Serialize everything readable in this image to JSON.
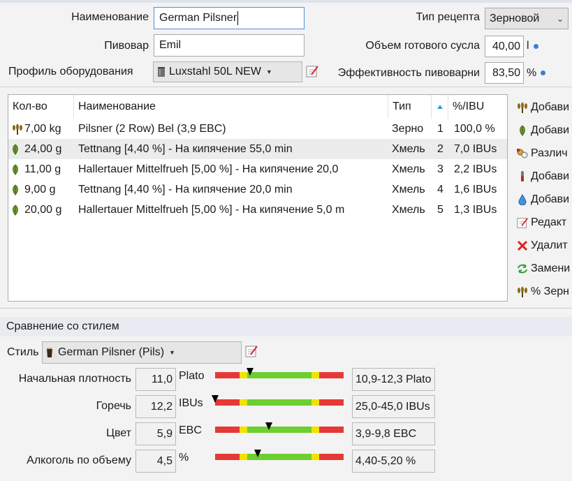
{
  "header": {
    "name_label": "Наименование",
    "name_value": "German Pilsner",
    "brewer_label": "Пивовар",
    "brewer_value": "Emil",
    "equipment_label": "Профиль оборудования",
    "equipment_value": "Luxstahl 50L NEW",
    "recipe_type_label": "Тип рецепта",
    "recipe_type_value": "Зерновой",
    "batch_volume_label": "Объем готового сусла",
    "batch_volume_value": "40,00",
    "batch_volume_unit": "l",
    "efficiency_label": "Эффективность пивоварни",
    "efficiency_value": "83,50",
    "efficiency_unit": "%"
  },
  "ingredients": {
    "columns": {
      "qty": "Кол-во",
      "name": "Наименование",
      "type": "Тип",
      "order_icon": "hop-order-icon",
      "pct": "%/IBU"
    },
    "rows": [
      {
        "icon": "grain-icon",
        "qty": "7,00 kg",
        "name": "Pilsner (2 Row) Bel (3,9 EBC)",
        "type": "Зерно",
        "order": "1",
        "pct": "100,0 %"
      },
      {
        "icon": "hop-icon",
        "qty": "24,00 g",
        "name": "Tettnang [4,40 %] - На кипячение 55,0 min",
        "type": "Хмель",
        "order": "2",
        "pct": "7,0 IBUs"
      },
      {
        "icon": "hop-icon",
        "qty": "11,00 g",
        "name": "Hallertauer Mittelfrueh [5,00 %] - На кипячение 20,0",
        "type": "Хмель",
        "order": "3",
        "pct": "2,2 IBUs"
      },
      {
        "icon": "hop-icon",
        "qty": "9,00 g",
        "name": "Tettnang [4,40 %] - На кипячение 20,0 min",
        "type": "Хмель",
        "order": "4",
        "pct": "1,6 IBUs"
      },
      {
        "icon": "hop-icon",
        "qty": "20,00 g",
        "name": "Hallertauer Mittelfrueh [5,00 %] - На кипячение 5,0 m",
        "type": "Хмель",
        "order": "5",
        "pct": "1,3 IBUs"
      }
    ]
  },
  "actions": [
    {
      "icon": "grain-icon",
      "label": "Добави"
    },
    {
      "icon": "hop-icon",
      "label": "Добави"
    },
    {
      "icon": "misc-icon",
      "label": "Различ"
    },
    {
      "icon": "yeast-icon",
      "label": "Добави"
    },
    {
      "icon": "water-icon",
      "label": "Добави"
    },
    {
      "icon": "edit-icon",
      "label": "Редакт"
    },
    {
      "icon": "delete-icon",
      "label": "Удалит"
    },
    {
      "icon": "replace-icon",
      "label": "Замени"
    },
    {
      "icon": "grain-icon",
      "label": "% Зерн"
    }
  ],
  "style": {
    "section_title": "Сравнение со стилем",
    "style_label": "Стиль",
    "style_value": "German Pilsner (Pils)",
    "metrics": [
      {
        "label": "Начальная плотность",
        "value": "11,0",
        "unit": "Plato",
        "range": "10,9-12,3 Plato",
        "marker": 0.27
      },
      {
        "label": "Горечь",
        "value": "12,2",
        "unit": "IBUs",
        "range": "25,0-45,0 IBUs",
        "marker": 0.0
      },
      {
        "label": "Цвет",
        "value": "5,9",
        "unit": "EBC",
        "range": "3,9-9,8 EBC",
        "marker": 0.42
      },
      {
        "label": "Алкоголь по объему",
        "value": "4,5",
        "unit": "%",
        "range": "4,40-5,20 %",
        "marker": 0.33
      }
    ]
  },
  "colors": {
    "bar_red": "#e53935",
    "bar_yellow": "#f2e200",
    "bar_green": "#6ccf2e",
    "accent_blue": "#3b7fd3"
  }
}
